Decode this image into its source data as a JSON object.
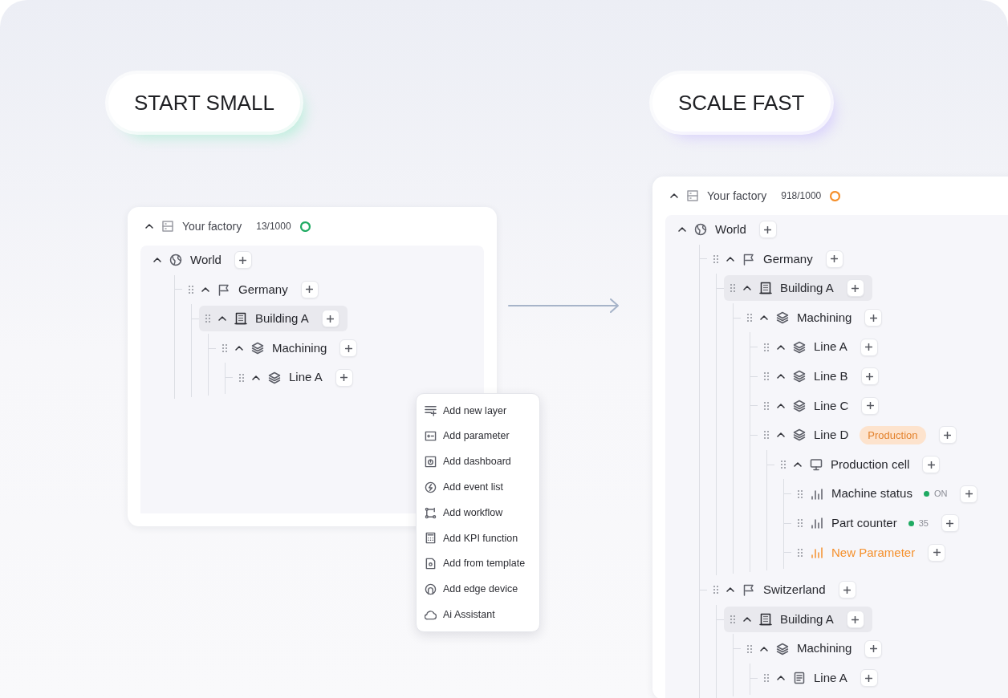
{
  "headlines": [
    {
      "text": "START SMALL",
      "color": "#bfeedd"
    },
    {
      "text": "SCALE FAST",
      "color": "#d9d2fb"
    }
  ],
  "panels": [
    {
      "title": "Your factory",
      "count": "13/1000",
      "color": "#1faa62",
      "tree": [
        {
          "kind": "globe",
          "label": "World",
          "expanded": true,
          "selected": false,
          "children": [
            {
              "kind": "flag",
              "label": "Germany",
              "expanded": true,
              "selected": false,
              "children": [
                {
                  "kind": "building",
                  "label": "Building A",
                  "expanded": true,
                  "selected": true,
                  "children": [
                    {
                      "kind": "layers",
                      "label": "Machining",
                      "expanded": true,
                      "selected": false,
                      "children": [
                        {
                          "kind": "layers",
                          "label": "Line A",
                          "expanded": true,
                          "selected": false
                        }
                      ]
                    }
                  ]
                }
              ]
            }
          ]
        }
      ],
      "menu": [
        {
          "kind": "layer",
          "label": "Add new layer"
        },
        {
          "kind": "parameter",
          "label": "Add parameter"
        },
        {
          "kind": "dashboard",
          "label": "Add dashboard"
        },
        {
          "kind": "event",
          "label": "Add event list"
        },
        {
          "kind": "workflow",
          "label": "Add workflow"
        },
        {
          "kind": "kpi",
          "label": "Add KPI function"
        },
        {
          "kind": "template",
          "label": "Add from template"
        },
        {
          "kind": "edge",
          "label": "Add edge device"
        },
        {
          "kind": "ai",
          "label": "Ai Assistant"
        }
      ]
    },
    {
      "title": "Your factory",
      "count": "918/1000",
      "color": "#f5902c",
      "tree": [
        {
          "kind": "globe",
          "label": "World",
          "expanded": true,
          "selected": false,
          "children": [
            {
              "kind": "flag",
              "label": "Germany",
              "expanded": true,
              "selected": false,
              "children": [
                {
                  "kind": "building",
                  "label": "Building A",
                  "expanded": true,
                  "selected": true,
                  "children": [
                    {
                      "kind": "layers",
                      "label": "Machining",
                      "expanded": true,
                      "selected": false,
                      "children": [
                        {
                          "kind": "layers",
                          "label": "Line A",
                          "expanded": true,
                          "selected": false
                        },
                        {
                          "kind": "layers",
                          "label": "Line B",
                          "expanded": true,
                          "selected": false
                        },
                        {
                          "kind": "layers",
                          "label": "Line C",
                          "expanded": true,
                          "selected": false
                        },
                        {
                          "kind": "layers",
                          "label": "Line D",
                          "expanded": true,
                          "selected": false,
                          "badge": "Production",
                          "children": [
                            {
                              "kind": "monitor",
                              "label": "Production cell",
                              "expanded": true,
                              "selected": false,
                              "children": [
                                {
                                  "kind": "chart",
                                  "label": "Machine status",
                                  "selected": false,
                                  "new": false,
                                  "status": {
                                    "text": "ON",
                                    "color": "#1faa62"
                                  }
                                },
                                {
                                  "kind": "chart",
                                  "label": "Part counter",
                                  "selected": false,
                                  "new": false,
                                  "status": {
                                    "text": "35",
                                    "color": "#1faa62"
                                  }
                                },
                                {
                                  "kind": "chart",
                                  "label": "New Parameter",
                                  "selected": false,
                                  "new": true
                                }
                              ]
                            }
                          ]
                        }
                      ]
                    }
                  ]
                }
              ]
            },
            {
              "kind": "flag",
              "label": "Switzerland",
              "expanded": true,
              "selected": false,
              "children": [
                {
                  "kind": "building",
                  "label": "Building A",
                  "expanded": true,
                  "selected": true,
                  "children": [
                    {
                      "kind": "layers",
                      "label": "Machining",
                      "expanded": true,
                      "selected": false,
                      "children": [
                        {
                          "kind": "document",
                          "label": "Line A",
                          "expanded": true,
                          "selected": false
                        }
                      ]
                    }
                  ]
                }
              ]
            }
          ]
        }
      ]
    }
  ]
}
